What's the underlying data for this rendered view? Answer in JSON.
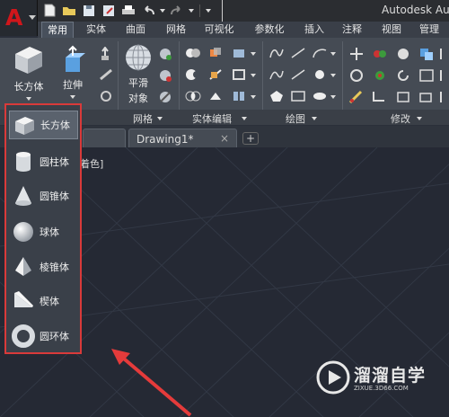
{
  "app": {
    "title": "Autodesk Au"
  },
  "tabs": [
    "常用",
    "实体",
    "曲面",
    "网格",
    "可视化",
    "参数化",
    "插入",
    "注释",
    "视图",
    "管理"
  ],
  "ribbon": {
    "big_tools": {
      "box": "长方体",
      "extrude": "拉伸",
      "smooth_line1": "平滑",
      "smooth_line2": "对象"
    },
    "panel_titles": {
      "mesh": "网格",
      "solid_edit": "实体编辑",
      "draw": "绘图",
      "modify": "修改"
    }
  },
  "dropdown": {
    "items": [
      {
        "label": "长方体",
        "icon": "box-icon"
      },
      {
        "label": "圆柱体",
        "icon": "cylinder-icon"
      },
      {
        "label": "圆锥体",
        "icon": "cone-icon"
      },
      {
        "label": "球体",
        "icon": "sphere-icon"
      },
      {
        "label": "棱锥体",
        "icon": "pyramid-icon"
      },
      {
        "label": "楔体",
        "icon": "wedge-icon"
      },
      {
        "label": "圆环体",
        "icon": "torus-icon"
      }
    ],
    "selected_index": 0
  },
  "file_tabs": {
    "active": "Drawing1*",
    "close": "×",
    "new": "+"
  },
  "viewport": {
    "label": "着色]"
  },
  "watermark": {
    "name": "溜溜自学",
    "url": "ZIXUE.3D66.COM"
  },
  "colors": {
    "highlight": "#d93a3a",
    "app_logo": "#d0161b",
    "canvas": "#252934"
  }
}
